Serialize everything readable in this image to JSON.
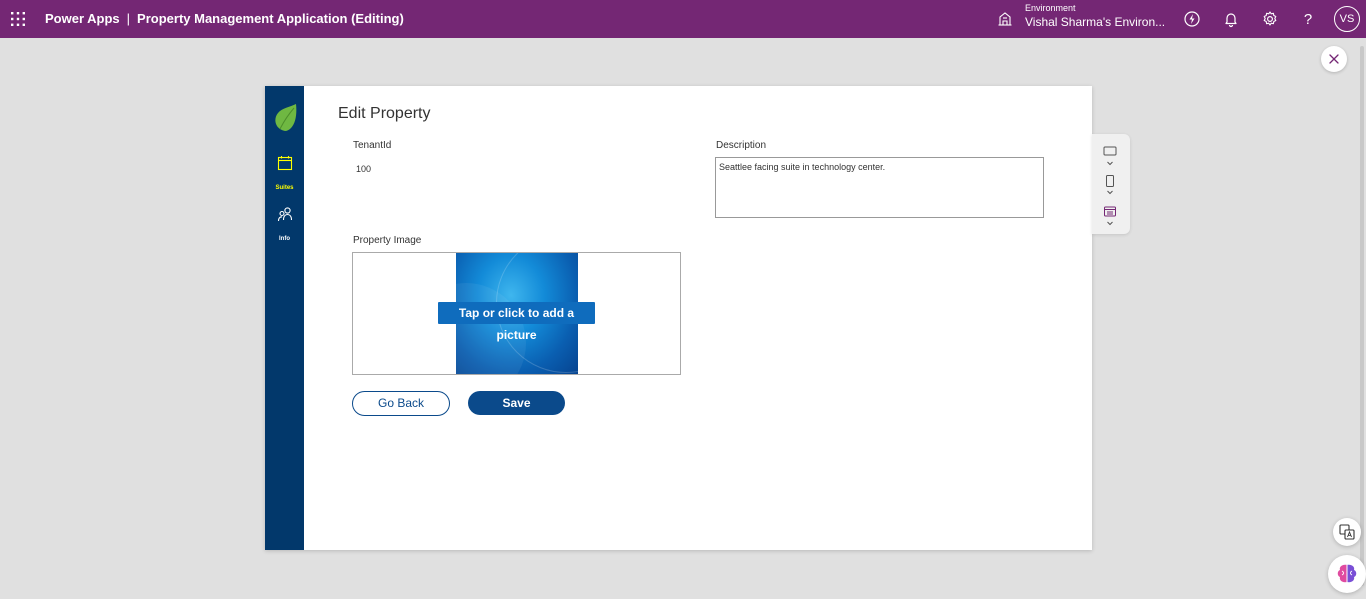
{
  "topbar": {
    "app_name": "Power Apps",
    "separator": "|",
    "app_title": "Property Management Application (Editing)",
    "environment_label": "Environment",
    "environment_name": "Vishal Sharma's Environ...",
    "avatar_initials": "VS"
  },
  "nav": {
    "items": [
      {
        "label": "Suites",
        "icon": "calendar-icon",
        "active": true
      },
      {
        "label": "Info",
        "icon": "people-icon",
        "active": false
      }
    ]
  },
  "screen": {
    "title": "Edit Property",
    "tenant_label": "TenantId",
    "tenant_value": "100",
    "description_label": "Description",
    "description_value": "Seattlee facing suite in technology center.",
    "image_label": "Property Image",
    "add_picture_label": "Tap or click to add a picture",
    "go_back_label": "Go Back",
    "save_label": "Save"
  },
  "colors": {
    "topbar": "#742774",
    "nav": "#02386b",
    "accent_yellow": "#ffff00",
    "button_primary": "#0b4a8b",
    "add_picture_bg": "#0f6cbd"
  }
}
